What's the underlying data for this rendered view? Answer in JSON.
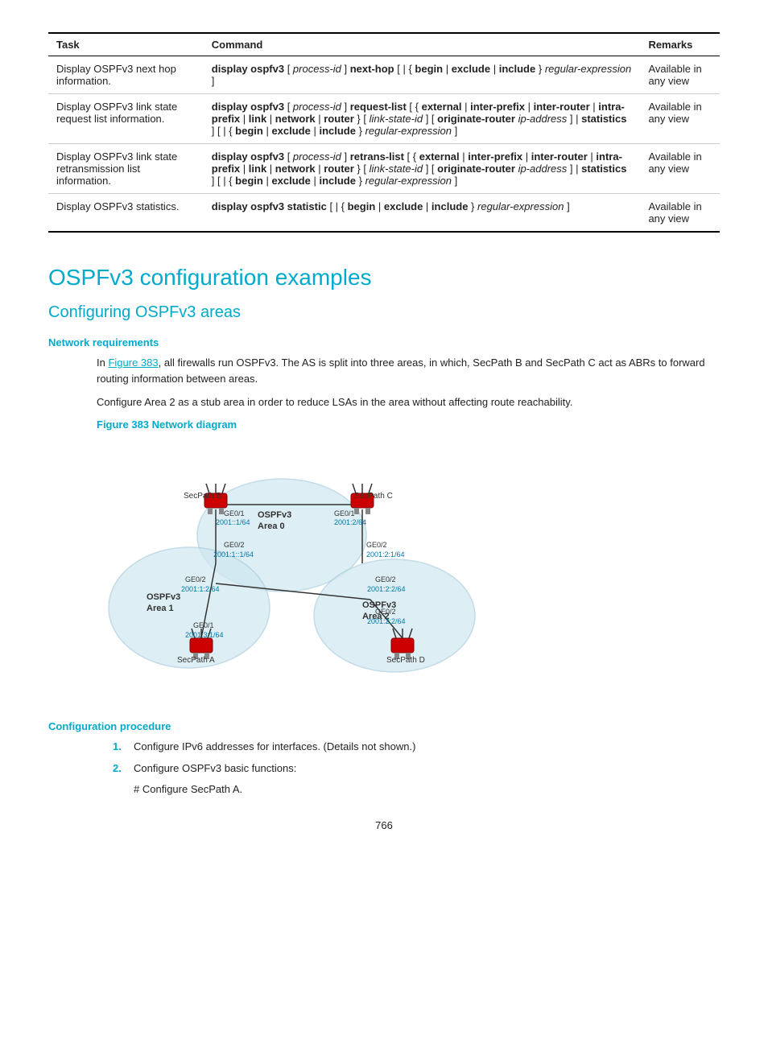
{
  "table": {
    "headers": [
      "Task",
      "Command",
      "Remarks"
    ],
    "rows": [
      {
        "task": "Display OSPFv3 next hop information.",
        "command_html": "<span class='cmd'>display ospfv3</span> [ <span class='cmd-italic'>process-id</span> ] <span class='cmd'>next-hop</span> [ | { <span class='cmd'>begin</span> | <span class='cmd'>exclude</span> | <span class='cmd'>include</span> } <span class='cmd-italic'>regular-expression</span> ]",
        "remarks": "Available in any view"
      },
      {
        "task": "Display OSPFv3 link state request list information.",
        "command_html": "<span class='cmd'>display ospfv3</span> [ <span class='cmd-italic'>process-id</span> ] <span class='cmd'>request-list</span> [ { <span class='cmd'>external</span> | <span class='cmd'>inter-prefix</span> | <span class='cmd'>inter-router</span> | <span class='cmd'>intra-prefix</span> | <span class='cmd'>link</span> | <span class='cmd'>network</span> | <span class='cmd'>router</span> } [ <span class='cmd-italic'>link-state-id</span> ] [ <span class='cmd'>originate-router</span> <span class='cmd-italic'>ip-address</span> ] | <span class='cmd'>statistics</span> ] [ | { <span class='cmd'>begin</span> | <span class='cmd'>exclude</span> | <span class='cmd'>include</span> } <span class='cmd-italic'>regular-expression</span> ]",
        "remarks": "Available in any view"
      },
      {
        "task": "Display OSPFv3 link state retransmission list information.",
        "command_html": "<span class='cmd'>display ospfv3</span> [ <span class='cmd-italic'>process-id</span> ] <span class='cmd'>retrans-list</span> [ { <span class='cmd'>external</span> | <span class='cmd'>inter-prefix</span> | <span class='cmd'>inter-router</span> | <span class='cmd'>intra-prefix</span> | <span class='cmd'>link</span> | <span class='cmd'>network</span> | <span class='cmd'>router</span> } [ <span class='cmd-italic'>link-state-id</span> ] [ <span class='cmd'>originate-router</span> <span class='cmd-italic'>ip-address</span> ] | <span class='cmd'>statistics</span> ] [ | { <span class='cmd'>begin</span> | <span class='cmd'>exclude</span> | <span class='cmd'>include</span> } <span class='cmd-italic'>regular-expression</span> ]",
        "remarks": "Available in any view"
      },
      {
        "task": "Display OSPFv3 statistics.",
        "command_html": "<span class='cmd'>display ospfv3 statistic</span> [ | { <span class='cmd'>begin</span> | <span class='cmd'>exclude</span> | <span class='cmd'>include</span> } <span class='cmd-italic'>regular-expression</span> ]",
        "remarks": "Available in any view"
      }
    ]
  },
  "section": {
    "title": "OSPFv3 configuration examples",
    "subtitle": "Configuring OSPFv3 areas"
  },
  "network_requirements": {
    "heading": "Network requirements",
    "paragraph1_pre": "In ",
    "paragraph1_link": "Figure 383",
    "paragraph1_post": ", all firewalls run OSPFv3. The AS is split into three areas, in which, SecPath B and SecPath C act as ABRs to forward routing information between areas.",
    "paragraph2": "Configure Area 2 as a stub area in order to reduce LSAs in the area without affecting route reachability.",
    "figure_label": "Figure 383 Network diagram"
  },
  "config_procedure": {
    "heading": "Configuration procedure",
    "steps": [
      {
        "num": "1.",
        "text": "Configure IPv6 addresses for interfaces. (Details not shown.)"
      },
      {
        "num": "2.",
        "text": "Configure OSPFv3 basic functions:"
      }
    ],
    "step2_sub": "# Configure SecPath A."
  },
  "page_number": "766"
}
